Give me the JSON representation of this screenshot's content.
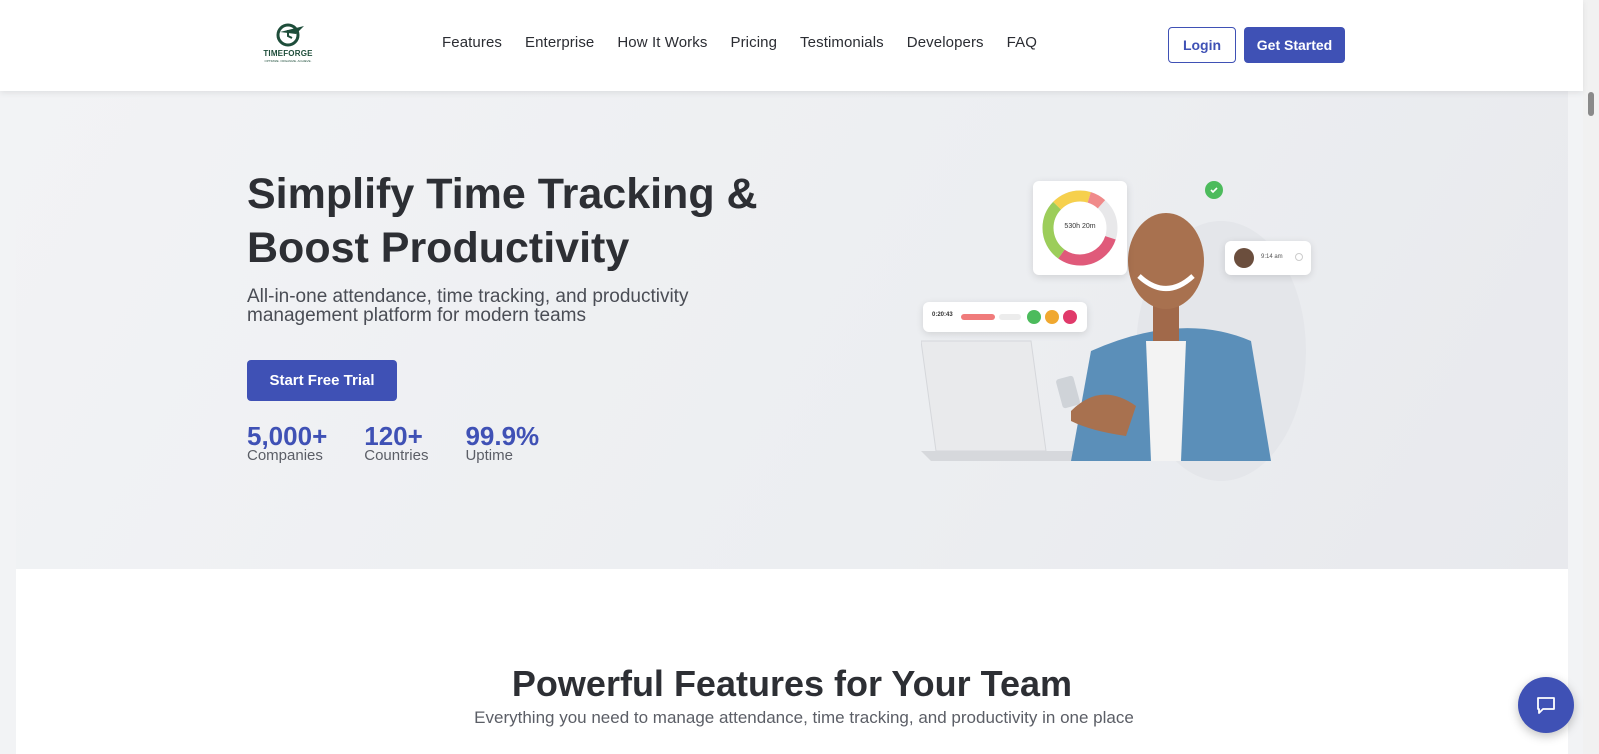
{
  "brand": {
    "name": "TIMEFORGE",
    "tagline": "OPTIMIZE. ORGANIZE. ACHIEVE.",
    "accent_color": "#3f51b5"
  },
  "nav": {
    "items": [
      {
        "label": "Features"
      },
      {
        "label": "Enterprise"
      },
      {
        "label": "How It Works"
      },
      {
        "label": "Pricing"
      },
      {
        "label": "Testimonials"
      },
      {
        "label": "Developers"
      },
      {
        "label": "FAQ"
      }
    ],
    "login_label": "Login",
    "get_started_label": "Get Started"
  },
  "hero": {
    "title_line1": "Simplify Time Tracking &",
    "title_line2": "Boost Productivity",
    "subtitle": "All-in-one attendance, time tracking, and productivity management platform for modern teams",
    "cta_label": "Start Free Trial",
    "stats": [
      {
        "value": "5,000+",
        "label": "Companies"
      },
      {
        "value": "120+",
        "label": "Countries"
      },
      {
        "value": "99.9%",
        "label": "Uptime"
      }
    ],
    "illustration": {
      "donut_label": "530h 20m",
      "timer_value": "0:20:43",
      "notification_time": "9:14 am"
    }
  },
  "features": {
    "title": "Powerful Features for Your Team",
    "subtitle": "Everything you need to manage attendance, time tracking, and productivity in one place"
  },
  "icons": {
    "chat": "chat-bubble-icon",
    "check": "check-circle-icon"
  }
}
